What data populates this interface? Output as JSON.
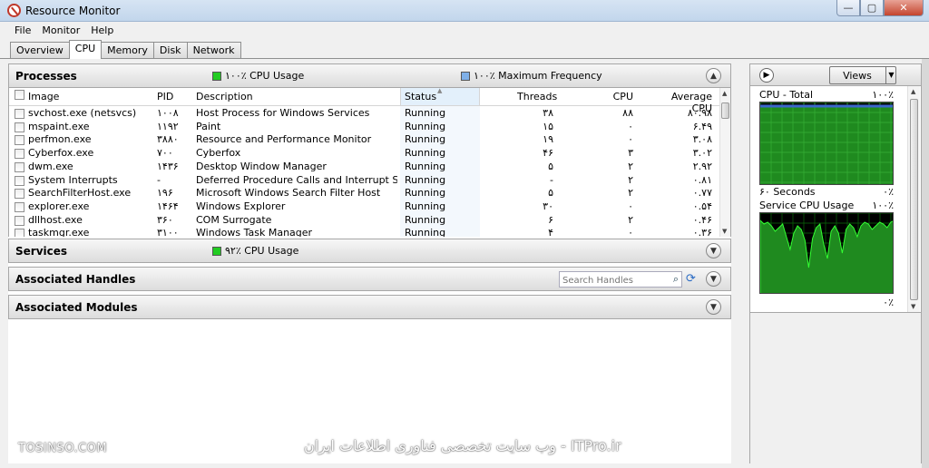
{
  "window": {
    "title": "Resource Monitor",
    "minimize": "—",
    "maximize": "▢",
    "close": "✕"
  },
  "menu": [
    "File",
    "Monitor",
    "Help"
  ],
  "tabs": [
    "Overview",
    "CPU",
    "Memory",
    "Disk",
    "Network"
  ],
  "processes": {
    "title": "Processes",
    "cpu_usage": "۱۰۰٪ CPU Usage",
    "max_freq": "۱۰۰٪ Maximum Frequency",
    "columns": {
      "image": "Image",
      "pid": "PID",
      "description": "Description",
      "status": "Status",
      "threads": "Threads",
      "cpu": "CPU",
      "avg_cpu": "Average CPU"
    },
    "rows": [
      {
        "image": "svchost.exe (netsvcs)",
        "pid": "۱۰۰۸",
        "description": "Host Process for Windows Services",
        "status": "Running",
        "threads": "۳۸",
        "cpu": "۸۸",
        "avg": "۸۰.۹۸"
      },
      {
        "image": "mspaint.exe",
        "pid": "۱۱۹۲",
        "description": "Paint",
        "status": "Running",
        "threads": "۱۵",
        "cpu": "۰",
        "avg": "۶.۴۹"
      },
      {
        "image": "perfmon.exe",
        "pid": "۳۸۸۰",
        "description": "Resource and Performance Monitor",
        "status": "Running",
        "threads": "۱۹",
        "cpu": "۰",
        "avg": "۳.۰۸"
      },
      {
        "image": "Cyberfox.exe",
        "pid": "۷۰۰",
        "description": "Cyberfox",
        "status": "Running",
        "threads": "۴۶",
        "cpu": "۳",
        "avg": "۳.۰۲"
      },
      {
        "image": "dwm.exe",
        "pid": "۱۴۳۶",
        "description": "Desktop Window Manager",
        "status": "Running",
        "threads": "۵",
        "cpu": "۲",
        "avg": "۲.۹۲"
      },
      {
        "image": "System Interrupts",
        "pid": "-",
        "description": "Deferred Procedure Calls and Interrupt Service ...",
        "status": "Running",
        "threads": "-",
        "cpu": "۲",
        "avg": "۰.۸۱"
      },
      {
        "image": "SearchFilterHost.exe",
        "pid": "۱۹۶",
        "description": "Microsoft Windows Search Filter Host",
        "status": "Running",
        "threads": "۵",
        "cpu": "۲",
        "avg": "۰.۷۷"
      },
      {
        "image": "explorer.exe",
        "pid": "۱۴۶۴",
        "description": "Windows Explorer",
        "status": "Running",
        "threads": "۳۰",
        "cpu": "۰",
        "avg": "۰.۵۴"
      },
      {
        "image": "dllhost.exe",
        "pid": "۳۶۰",
        "description": "COM Surrogate",
        "status": "Running",
        "threads": "۶",
        "cpu": "۲",
        "avg": "۰.۴۶"
      },
      {
        "image": "taskmgr.exe",
        "pid": "۳۱۰۰",
        "description": "Windows Task Manager",
        "status": "Running",
        "threads": "۴",
        "cpu": "۰",
        "avg": "۰.۳۶"
      }
    ]
  },
  "services": {
    "title": "Services",
    "cpu_usage": "۹۲٪ CPU Usage"
  },
  "handles": {
    "title": "Associated Handles",
    "search_placeholder": "Search Handles"
  },
  "modules": {
    "title": "Associated Modules"
  },
  "right_panel": {
    "views_label": "Views",
    "graph1": {
      "title": "CPU - Total",
      "top": "۱۰۰٪",
      "bottom_left": "۶۰ Seconds",
      "bottom_right": "۰٪"
    },
    "graph2": {
      "title": "Service CPU Usage",
      "top": "۱۰۰٪",
      "bottom_right": "۰٪"
    }
  },
  "colors": {
    "cpu_green": "#22cc22",
    "freq_blue": "#7fb0e8",
    "graph_fill": "#1f8a1f",
    "graph_line": "#33ff33",
    "graph_blue": "#3a66cc"
  },
  "watermarks": {
    "left": "TOSINSO.COM",
    "center": "ITPro.ir - وب سایت تخصصی فناوری اطلاعات ایران"
  }
}
